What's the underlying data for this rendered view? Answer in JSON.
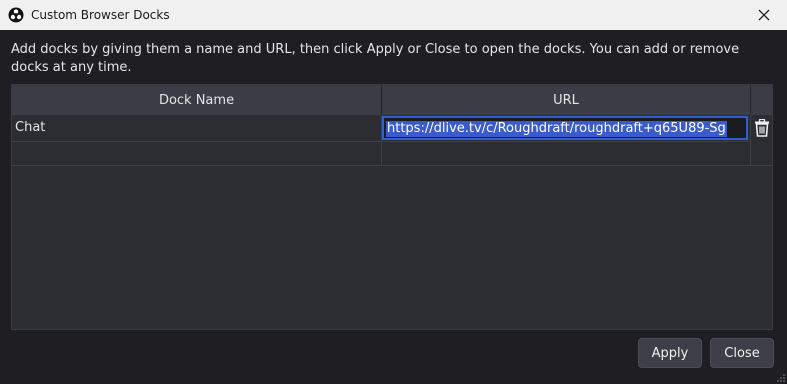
{
  "window": {
    "title": "Custom Browser Docks",
    "icon": "obs-logo-icon"
  },
  "instructions": "Add docks by giving them a name and URL, then click Apply or Close to open the docks. You can add or remove docks at any time.",
  "table": {
    "headers": [
      "Dock Name",
      "URL"
    ],
    "rows": [
      {
        "name": "Chat",
        "url": "https://dlive.tv/c/Roughdraft/roughdraft+q65U89-Sg"
      },
      {
        "name": "",
        "url": ""
      }
    ]
  },
  "buttons": {
    "apply": "Apply",
    "close": "Close"
  },
  "colors": {
    "accent": "#2f5fd1",
    "selection": "#3b5bcc",
    "background": "#1f1f23"
  }
}
